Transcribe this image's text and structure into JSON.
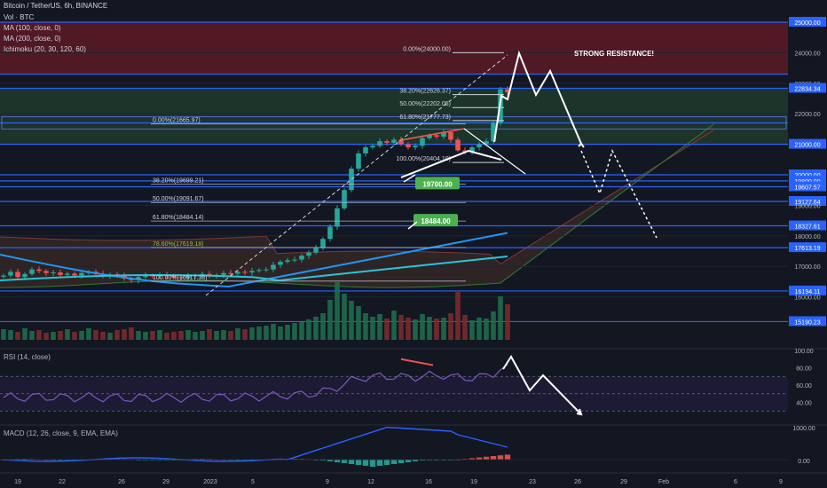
{
  "header": {
    "symbol_line": "Bitcoin / TetherUS, 6h, BINANCE",
    "volume_label": "Vol · BTC",
    "indicators": [
      "MA (100, close, 0)",
      "MA (200, close, 0)",
      "Ichimoku (20, 30, 120, 60)"
    ]
  },
  "panes": {
    "rsi_label": "RSI (14, close)",
    "macd_label": "MACD (12, 26, close, 9, EMA, EMA)"
  },
  "colors": {
    "background": "#131722",
    "up": "#26a69a",
    "up_bright": "#16c784",
    "down": "#ef5350",
    "level_line": "#2962ff",
    "resistance_zone": "#5c1a24",
    "support_zone": "#1e3a2a",
    "ma100": "#2196f3",
    "ma200": "#26c6da",
    "rsi": "#7e57c2",
    "macd": "#2962ff",
    "target_tag": "#4caf50"
  },
  "chart_data": [
    {
      "type": "candlestick",
      "title": "Bitcoin / TetherUS, 6h, BINANCE",
      "ylim": [
        15000,
        25000
      ],
      "y_ticks": [
        16000,
        17000,
        18000,
        19000,
        20000,
        21000,
        22000,
        23000,
        24000,
        25000
      ],
      "x_tick_labels": [
        "19",
        "22",
        "26",
        "29",
        "2023",
        "5",
        "9",
        "12",
        "16",
        "19",
        "23",
        "26",
        "29",
        "Feb",
        "6",
        "9"
      ],
      "price_tags": [
        "25000.00",
        "24000.00",
        "23000.00",
        "22834.34",
        "22000.00",
        "21000.00",
        "20000.00",
        "19800.00",
        "19607.57",
        "19127.64",
        "19000.00",
        "18327.61",
        "18000.00",
        "17613.19",
        "17000.00",
        "16194.11",
        "16000.00",
        "15190.23"
      ],
      "horizontal_levels": [
        25000,
        23300,
        22834.34,
        21700,
        21000,
        20000,
        19800,
        19607.57,
        19127.64,
        18327.61,
        17613.19,
        16194.11,
        15190.23
      ],
      "zones": [
        {
          "name": "resistance",
          "from": 23300,
          "to": 25000
        },
        {
          "name": "range",
          "from": 21000,
          "to": 22834.34
        }
      ],
      "fib_levels_high": [
        {
          "label": "0.00%(24000.00)",
          "price": 24000
        },
        {
          "label": "38.20%(22626.37)",
          "price": 22626.37
        },
        {
          "label": "50.00%(22202.05)",
          "price": 22202.05
        },
        {
          "label": "61.80%(21777.73)",
          "price": 21777.73
        },
        {
          "label": "100.00%(20404.10)",
          "price": 20404.1
        }
      ],
      "fib_levels_low": [
        {
          "label": "0.00%(21665.97)",
          "price": 21665.97
        },
        {
          "label": "38.20%(19699.21)",
          "price": 19699.21
        },
        {
          "label": "50.00%(19091.67)",
          "price": 19091.67
        },
        {
          "label": "61.80%(18484.14)",
          "price": 18484.14
        },
        {
          "label": "78.60%(17619.18)",
          "price": 17619.18
        },
        {
          "label": "100.00%(16517.38)",
          "price": 16517.38
        }
      ],
      "targets": [
        {
          "label": "19700.00",
          "price": 19700
        },
        {
          "label": "18484.00",
          "price": 18484
        }
      ],
      "annotations": [
        "STRONG RESISTANCE!"
      ],
      "close_series": [
        16700,
        16820,
        16650,
        16750,
        16900,
        16850,
        16780,
        16800,
        16720,
        16760,
        16700,
        16780,
        16820,
        16750,
        16700,
        16740,
        16690,
        16600,
        16550,
        16650,
        16700,
        16680,
        16720,
        16700,
        16650,
        16620,
        16680,
        16700,
        16750,
        16690,
        16720,
        16780,
        16760,
        16820,
        16800,
        16850,
        16880,
        16900,
        17050,
        17150,
        17200,
        17220,
        17350,
        17450,
        17600,
        17900,
        18300,
        18900,
        19500,
        20200,
        20700,
        20900,
        20950,
        21100,
        21050,
        21150,
        21000,
        20900,
        20950,
        21200,
        21300,
        21250,
        21400,
        21150,
        20800,
        20750,
        20900,
        21000,
        21100,
        21700,
        22800,
        22700
      ],
      "volume_series": [
        1.2,
        1.1,
        0.9,
        1.3,
        1.0,
        1.1,
        0.8,
        0.9,
        1.0,
        1.2,
        0.9,
        1.0,
        1.3,
        1.1,
        0.9,
        0.8,
        1.1,
        1.2,
        1.4,
        1.0,
        0.9,
        1.0,
        1.1,
        0.8,
        0.9,
        1.0,
        1.1,
        0.9,
        1.0,
        1.2,
        1.0,
        1.1,
        1.0,
        1.3,
        1.2,
        1.4,
        1.5,
        1.6,
        1.8,
        1.5,
        1.7,
        1.9,
        2.0,
        2.3,
        2.6,
        3.0,
        4.5,
        6.5,
        5.2,
        4.4,
        3.8,
        3.0,
        2.6,
        2.9,
        2.4,
        3.3,
        2.8,
        2.5,
        2.3,
        2.9,
        2.6,
        2.4,
        2.5,
        3.0,
        5.4,
        2.8,
        2.2,
        2.5,
        2.4,
        3.2,
        4.9,
        4.0
      ]
    },
    {
      "type": "line",
      "title": "RSI (14, close)",
      "ylim": [
        20,
        100
      ],
      "y_ticks": [
        40,
        60,
        80,
        100
      ],
      "bands": [
        30,
        50,
        70
      ]
    },
    {
      "type": "line",
      "title": "MACD (12, 26, close, 9, EMA, EMA)",
      "y_ticks": [
        "0.00",
        "1000.00"
      ]
    }
  ]
}
